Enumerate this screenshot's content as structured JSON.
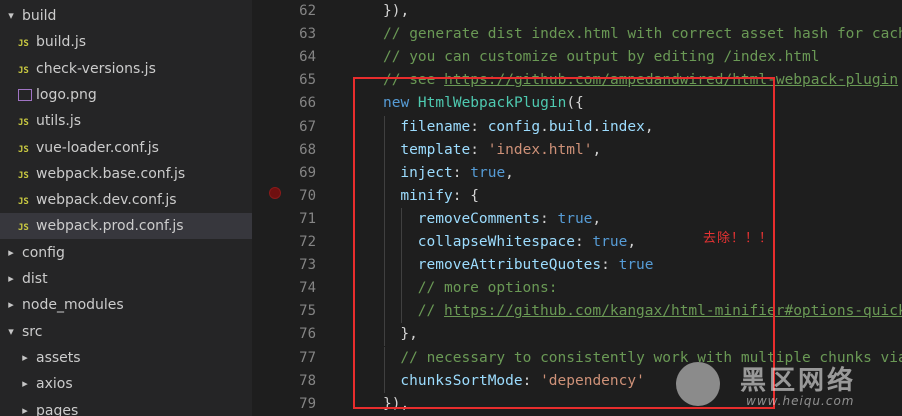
{
  "explorer": {
    "items": [
      {
        "label": "build",
        "type": "folder",
        "expanded": true,
        "level": 0
      },
      {
        "label": "build.js",
        "type": "js",
        "level": 1
      },
      {
        "label": "check-versions.js",
        "type": "js",
        "level": 1
      },
      {
        "label": "logo.png",
        "type": "image",
        "level": 1
      },
      {
        "label": "utils.js",
        "type": "js",
        "level": 1
      },
      {
        "label": "vue-loader.conf.js",
        "type": "js",
        "level": 1
      },
      {
        "label": "webpack.base.conf.js",
        "type": "js",
        "level": 1
      },
      {
        "label": "webpack.dev.conf.js",
        "type": "js",
        "level": 1
      },
      {
        "label": "webpack.prod.conf.js",
        "type": "js",
        "level": 1,
        "selected": true
      },
      {
        "label": "config",
        "type": "folder",
        "expanded": false,
        "level": 0
      },
      {
        "label": "dist",
        "type": "folder",
        "expanded": false,
        "level": 0
      },
      {
        "label": "node_modules",
        "type": "folder",
        "expanded": false,
        "level": 0
      },
      {
        "label": "src",
        "type": "folder",
        "expanded": true,
        "level": 0
      },
      {
        "label": "assets",
        "type": "folder",
        "expanded": false,
        "level": 1
      },
      {
        "label": "axios",
        "type": "folder",
        "expanded": false,
        "level": 1
      },
      {
        "label": "pages",
        "type": "folder",
        "expanded": false,
        "level": 1
      }
    ]
  },
  "editor": {
    "lines": [
      {
        "n": "62",
        "indent": 0,
        "tokens": [
          [
            "pun",
            "}),"
          ]
        ]
      },
      {
        "n": "63",
        "indent": 0,
        "tokens": [
          [
            "cm",
            "// generate dist index.html with correct asset hash for caching."
          ]
        ]
      },
      {
        "n": "64",
        "indent": 0,
        "tokens": [
          [
            "cm",
            "// you can customize output by editing /index.html"
          ]
        ]
      },
      {
        "n": "65",
        "indent": 0,
        "tokens": [
          [
            "cm",
            "// see "
          ],
          [
            "url",
            "https://github.com/ampedandwired/html-webpack-plugin"
          ]
        ]
      },
      {
        "n": "66",
        "indent": 0,
        "tokens": [
          [
            "kw",
            "new "
          ],
          [
            "cls",
            "HtmlWebpackPlugin"
          ],
          [
            "pun",
            "({"
          ]
        ]
      },
      {
        "n": "67",
        "indent": 1,
        "tokens": [
          [
            "prop",
            "filename"
          ],
          [
            "pun",
            ": "
          ],
          [
            "prop",
            "config"
          ],
          [
            "pun",
            "."
          ],
          [
            "prop",
            "build"
          ],
          [
            "pun",
            "."
          ],
          [
            "prop",
            "index"
          ],
          [
            "pun",
            ","
          ]
        ]
      },
      {
        "n": "68",
        "indent": 1,
        "tokens": [
          [
            "prop",
            "template"
          ],
          [
            "pun",
            ": "
          ],
          [
            "str",
            "'index.html'"
          ],
          [
            "pun",
            ","
          ]
        ]
      },
      {
        "n": "69",
        "indent": 1,
        "tokens": [
          [
            "prop",
            "inject"
          ],
          [
            "pun",
            ": "
          ],
          [
            "kw",
            "true"
          ],
          [
            "pun",
            ","
          ]
        ]
      },
      {
        "n": "70",
        "indent": 1,
        "tokens": [
          [
            "prop",
            "minify"
          ],
          [
            "pun",
            ": {"
          ]
        ]
      },
      {
        "n": "71",
        "indent": 2,
        "tokens": [
          [
            "prop",
            "removeComments"
          ],
          [
            "pun",
            ": "
          ],
          [
            "kw",
            "true"
          ],
          [
            "pun",
            ","
          ]
        ]
      },
      {
        "n": "72",
        "indent": 2,
        "tokens": [
          [
            "prop",
            "collapseWhitespace"
          ],
          [
            "pun",
            ": "
          ],
          [
            "kw",
            "true"
          ],
          [
            "pun",
            ","
          ]
        ]
      },
      {
        "n": "73",
        "indent": 2,
        "tokens": [
          [
            "prop",
            "removeAttributeQuotes"
          ],
          [
            "pun",
            ": "
          ],
          [
            "kw",
            "true"
          ]
        ]
      },
      {
        "n": "74",
        "indent": 2,
        "tokens": [
          [
            "cm",
            "// more options:"
          ]
        ]
      },
      {
        "n": "75",
        "indent": 2,
        "tokens": [
          [
            "cm",
            "// "
          ],
          [
            "url",
            "https://github.com/kangax/html-minifier#options-quick-reference"
          ]
        ]
      },
      {
        "n": "76",
        "indent": 1,
        "tokens": [
          [
            "pun",
            "},"
          ]
        ]
      },
      {
        "n": "77",
        "indent": 1,
        "tokens": [
          [
            "cm",
            "// necessary to consistently work with multiple chunks via CommonsChunkPlugin"
          ]
        ]
      },
      {
        "n": "78",
        "indent": 1,
        "tokens": [
          [
            "prop",
            "chunksSortMode"
          ],
          [
            "pun",
            ": "
          ],
          [
            "str",
            "'dependency'"
          ]
        ]
      },
      {
        "n": "79",
        "indent": 0,
        "tokens": [
          [
            "pun",
            "}),"
          ]
        ]
      }
    ],
    "breakpoint_line": "70"
  },
  "annotation": {
    "note": "去除！！！",
    "box_color": "#e82d2d"
  },
  "watermark": {
    "title": "黑区网络",
    "url": "www.heiqu.com"
  }
}
